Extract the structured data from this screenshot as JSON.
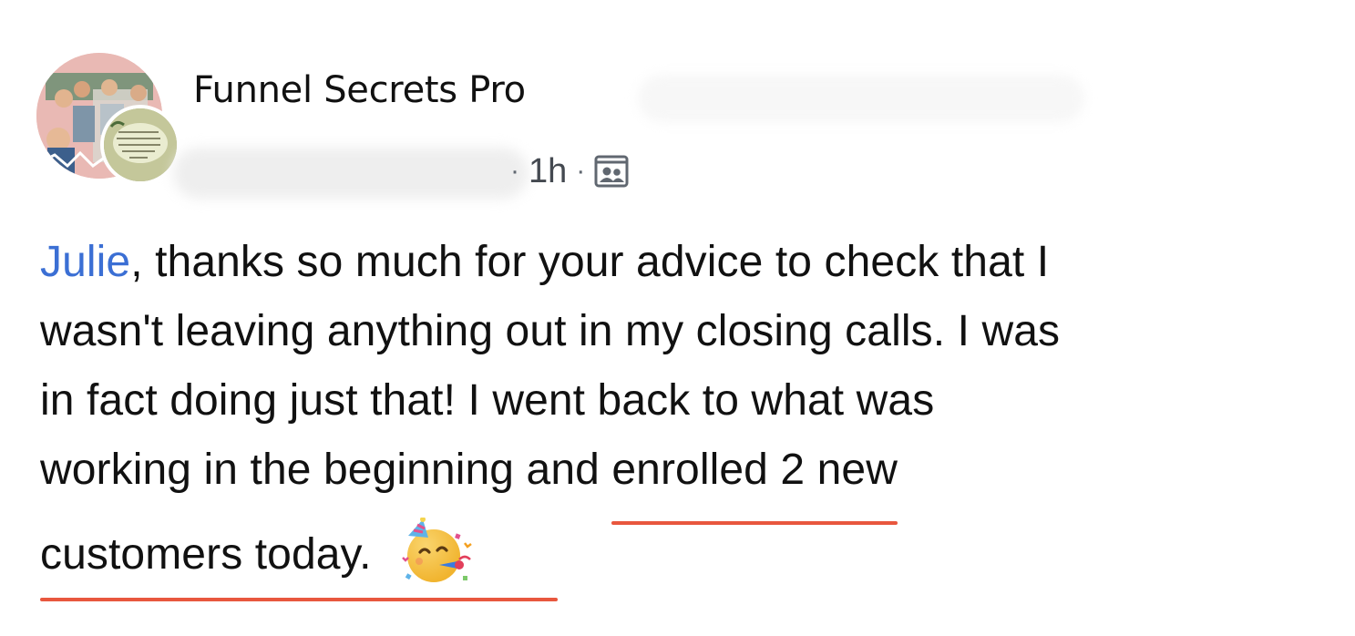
{
  "post": {
    "group_name": "Funnel Secrets Pro",
    "time": "1h",
    "meta_separator": "·",
    "audience_icon": "group-members-icon",
    "body": {
      "mention": "Julie",
      "line1_rest": ", thanks so much for your advice to check that I",
      "line2": "wasn't leaving anything out in my closing calls.  I was",
      "line3": "in fact doing just that!  I went back to what was",
      "line4_start": "working in the beginning and ",
      "line4_highlight": "enrolled 2 new",
      "line5": "customers today.",
      "emoji": "partying-face-emoji"
    }
  },
  "colors": {
    "mention": "#3b6fd4",
    "underline": "#e8573e",
    "text": "#111111",
    "meta": "#606770"
  }
}
